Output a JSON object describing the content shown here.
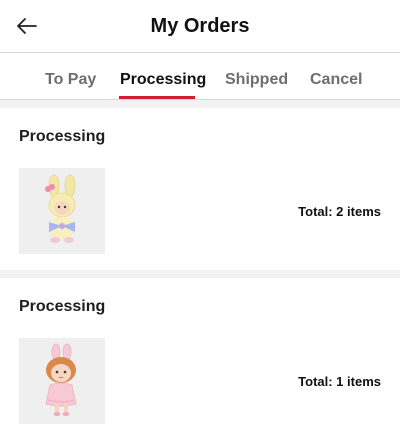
{
  "header": {
    "title": "My Orders"
  },
  "tabs": [
    {
      "label": "To Pay"
    },
    {
      "label": "Processing"
    },
    {
      "label": "Shipped"
    },
    {
      "label": "Cancel"
    }
  ],
  "active_tab": "Processing",
  "orders": [
    {
      "status": "Processing",
      "total": "Total: 2 items"
    },
    {
      "status": "Processing",
      "total": "Total: 1 items"
    }
  ],
  "colors": {
    "accent": "#d0212f",
    "divider": "#d9d9d9",
    "background_gap": "#f2f2f2"
  }
}
